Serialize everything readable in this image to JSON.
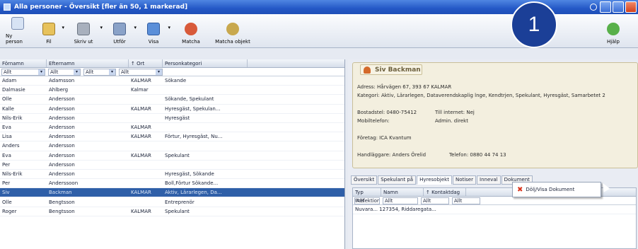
{
  "window": {
    "title": "Alla personer - Översikt [fler än 50, 1 markerad]"
  },
  "toolbar": {
    "items": [
      {
        "label": "Ny person",
        "icon": "new-person-icon"
      },
      {
        "label": "Fil",
        "icon": "file-icon"
      },
      {
        "label": "Skriv ut",
        "icon": "printer-icon"
      },
      {
        "label": "Utför",
        "icon": "tools-icon"
      },
      {
        "label": "Visa",
        "icon": "view-icon"
      },
      {
        "label": "Matcha",
        "icon": "match-icon"
      },
      {
        "label": "Matcha objekt",
        "icon": "match-object-icon"
      },
      {
        "label": "Hjälp",
        "icon": "help-icon"
      }
    ]
  },
  "badge": {
    "number": "1"
  },
  "grid": {
    "headers": [
      "Förnamn",
      "Efternamn",
      "↑ Ort",
      "Personkategori"
    ],
    "filters": [
      "Allt",
      "Allt",
      "Allt",
      "Allt"
    ],
    "rows": [
      {
        "c": [
          "Adam",
          "Adamsson",
          "KALMAR",
          "Sökande"
        ]
      },
      {
        "c": [
          "Dalmasie",
          "Ahlberg",
          "Kalmar",
          ""
        ]
      },
      {
        "c": [
          "Olle",
          "Andersson",
          "",
          "Sökande, Spekulant"
        ]
      },
      {
        "c": [
          "Kalle",
          "Andersson",
          "KALMAR",
          "Hyresgäst, Spekulan..."
        ]
      },
      {
        "c": [
          "Nils-Erik",
          "Andersson",
          "",
          "Hyresgäst"
        ]
      },
      {
        "c": [
          "Eva",
          "Andersson",
          "KALMAR",
          ""
        ]
      },
      {
        "c": [
          "Lisa",
          "Andersson",
          "KALMAR",
          "Förtur, Hyresgäst, Nu..."
        ]
      },
      {
        "c": [
          "Anders",
          "Andersson",
          "",
          ""
        ]
      },
      {
        "c": [
          "Eva",
          "Andersson",
          "KALMAR",
          "Spekulant"
        ]
      },
      {
        "c": [
          "Per",
          "Andersson",
          "",
          ""
        ]
      },
      {
        "c": [
          "Nils-Erik",
          "Andersson",
          "",
          "Hyresgäst, Sökande"
        ]
      },
      {
        "c": [
          "Per",
          "Anderssoon",
          "",
          "Boll,Förtur Sökande..."
        ]
      },
      {
        "c": [
          "Siv",
          "Backman",
          "KALMAR",
          "Aktiv, Lärarlegen, Da..."
        ],
        "selected": true
      },
      {
        "c": [
          "Olle",
          "Bengtsson",
          "",
          "Entreprenör"
        ]
      },
      {
        "c": [
          "Roger",
          "Bengtsson",
          "KALMAR",
          "Spekulant"
        ]
      }
    ]
  },
  "person": {
    "name": "Siv Backman",
    "address": "Adress: Hårvägen 67, 393 67 KALMAR",
    "categories": "Kategori: Aktiv, Lärarlegen, Dataverendskaplig lnge, Kendtrjen, Spekulant, Hyresgäst, Samarbetet 2",
    "phone": "Bostadstel: 0480-75412",
    "internet": "Till internet: Nej",
    "mobile": "Mobiltelefon:",
    "admin": "Admin. direkt",
    "company": "Företag: ICA Kvantum",
    "handler": "Handläggare: Anders Örelid",
    "fax": "Telefon: 0880 44 74 13"
  },
  "tabs": [
    "Översikt",
    "Spekulant på",
    "Hyresobjekt",
    "Notiser",
    "Inneval",
    "Dokument"
  ],
  "context_menu": {
    "item": "Dölj/Visa Dokument"
  },
  "doc": {
    "headers": [
      "Typ Prefektion",
      "Namn",
      "↑ Kontaktdag"
    ],
    "filters": [
      "Allt",
      "Allt",
      "Allt",
      "Allt"
    ],
    "row": "Nuvara... 127354, Riddaregata..."
  }
}
